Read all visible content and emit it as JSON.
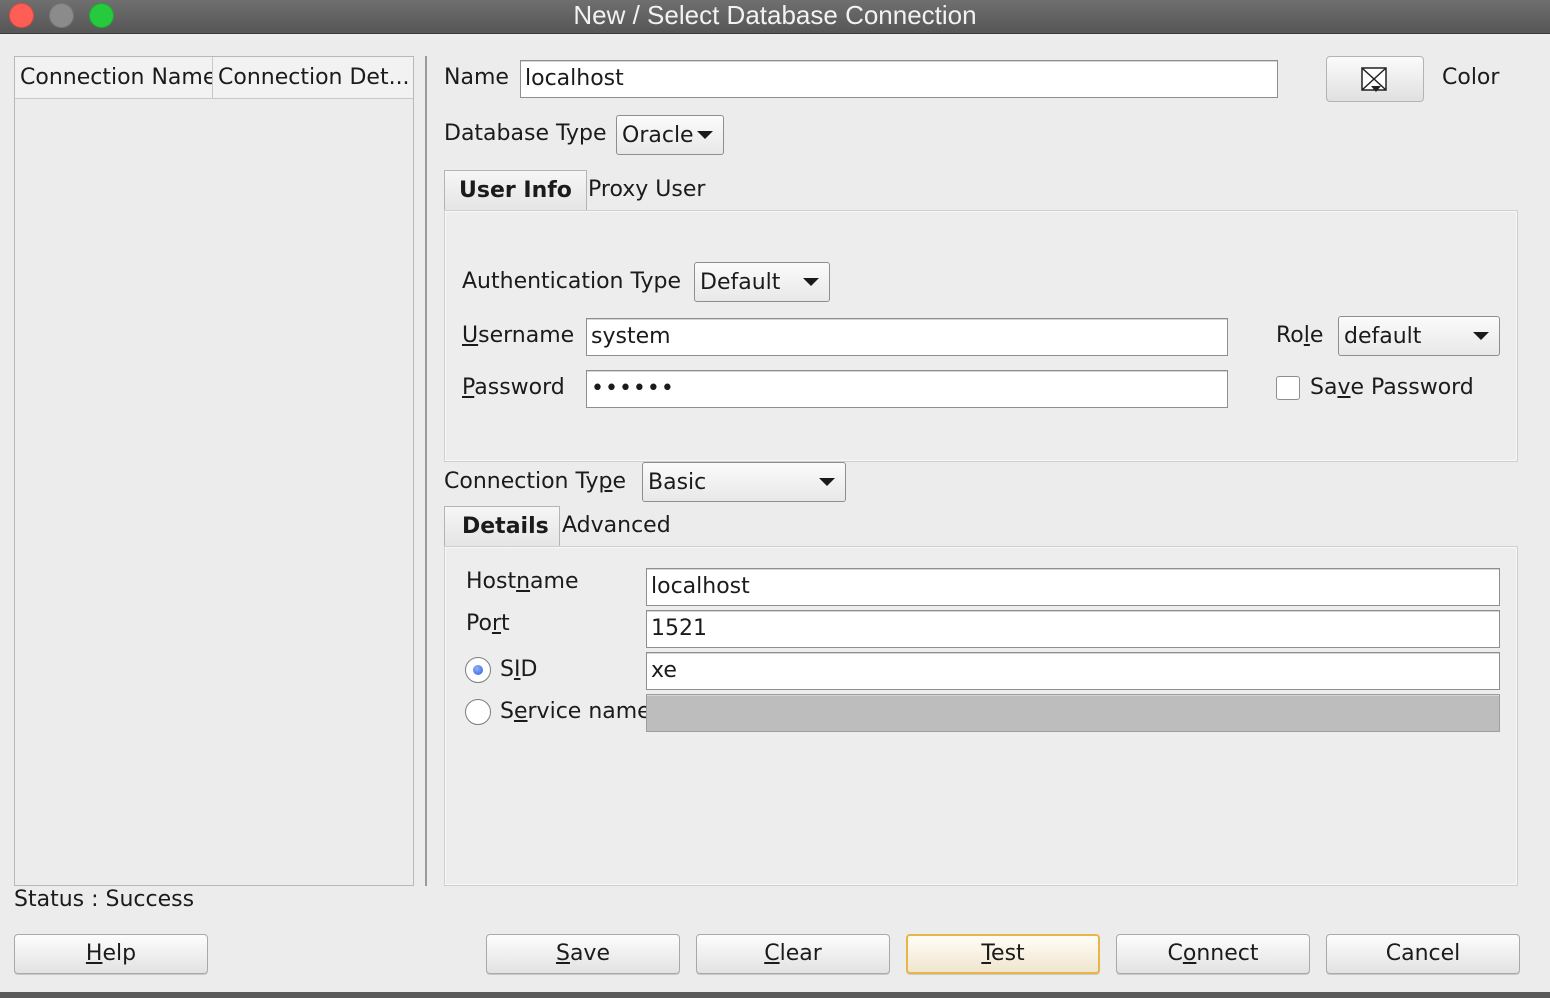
{
  "window": {
    "title": "New / Select Database Connection"
  },
  "connection_list": {
    "columns": [
      "Connection Name",
      "Connection Det..."
    ]
  },
  "form": {
    "name_label": "Name",
    "name_value": "localhost",
    "color_label": "Color",
    "database_type_label": "Database Type",
    "database_type_value": "Oracle",
    "tabs_user": [
      "User Info",
      "Proxy User"
    ],
    "auth_type_label": "Authentication Type",
    "auth_type_value": "Default",
    "username_label": "Username",
    "username_value": "system",
    "password_label": "Password",
    "password_value": "••••••",
    "role_label": "Role",
    "role_value": "default",
    "save_password_label": "Save Password",
    "save_password_checked": false,
    "connection_type_label": "Connection Type",
    "connection_type_value": "Basic",
    "tabs_conn": [
      "Details",
      "Advanced"
    ],
    "hostname_label": "Hostname",
    "hostname_value": "localhost",
    "port_label": "Port",
    "port_value": "1521",
    "sid_label": "SID",
    "sid_value": "xe",
    "sid_selected": true,
    "service_name_label": "Service name",
    "service_name_value": ""
  },
  "status": {
    "text": "Status : Success"
  },
  "buttons": {
    "help": "Help",
    "save": "Save",
    "clear": "Clear",
    "test": "Test",
    "connect": "Connect",
    "cancel": "Cancel"
  },
  "colors": {
    "window_bg": "#ececec",
    "title_bar": "#5f5f5f",
    "close": "#fd5f57",
    "minimize": "#8b8b8b",
    "zoom": "#27c93f",
    "focus_button_border": "#e9b54b",
    "radio_selected": "#2e5ad6"
  },
  "icons": {
    "color_picker": "color-swatch-icon",
    "dropdown": "chevron-down-icon"
  }
}
